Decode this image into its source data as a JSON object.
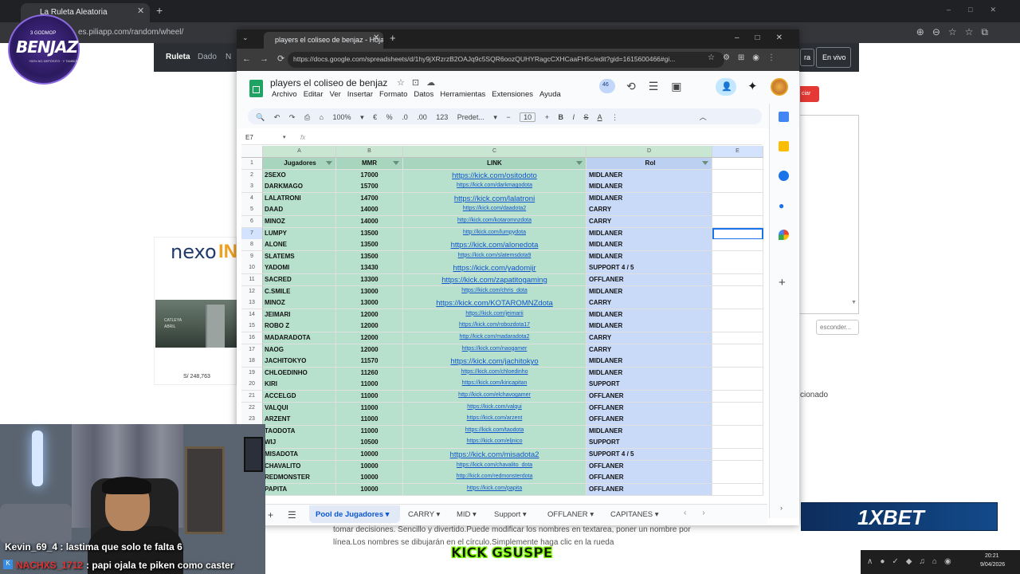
{
  "bg_browser": {
    "tab_title": "La Ruleta Aleatoria",
    "url": "es.piliapp.com/random/wheel/",
    "nav": {
      "roulette": "Ruleta",
      "dado": "Dado",
      "n": "N"
    },
    "nav_btn1": "ra",
    "nav_btn2": "En vivo",
    "red_btn": "ciar",
    "esconder": "esconder...",
    "cionado": "cionado",
    "paragraph": "tomar decisiones. Sencillo y divertido.Puede modificar los nombres en textarea, poner un nombre por línea.Los nombres se dibujarán en el círculo.Simplemente haga clic en la rueda"
  },
  "ad": {
    "logo_a": "nexo",
    "logo_b": "IN",
    "line1": "CATLEYA",
    "line2": "ABRIL",
    "price": "S/ 248,763"
  },
  "stream": {
    "logo_top": "3 GODMOP",
    "logo_name": "BENJAZ",
    "logo_sub": "+50% NO DEPÓSITO · Y TAMBOR",
    "kick": "KICK GSUSPE",
    "sponsor": "1XBET",
    "time": "20:21",
    "date": "9/04/2026"
  },
  "chat": [
    {
      "user": "Kevin_69_4",
      "msg": "lastima que solo te falta 6"
    },
    {
      "user": "NACHXS_1712",
      "msg": ": papi ojala te piken como caster"
    }
  ],
  "sheets": {
    "window_tab": "players el coliseo de benjaz - Hoja",
    "url": "https://docs.google.com/spreadsheets/d/1hy9jXRzrzB2OAJq9c5SQR6oozQUHYRagcCXHCaaFH5c/edit?gid=1615600466#gi...",
    "title": "players el coliseo de benjaz",
    "menu": [
      "Archivo",
      "Editar",
      "Ver",
      "Insertar",
      "Formato",
      "Datos",
      "Herramientas",
      "Extensiones",
      "Ayuda"
    ],
    "toolbar": {
      "zoom": "100%",
      "currency": "€",
      "percent": "%",
      "dec_minus": ".0",
      "dec_plus": ".00",
      "fmt_123": "123",
      "font": "Predet...",
      "font_size": "10",
      "bold": "B",
      "italic": "I",
      "strike": "S",
      "color": "A"
    },
    "badge": "46",
    "namebox": "E7",
    "col_letters": [
      "A",
      "B",
      "C",
      "D",
      "E"
    ],
    "headers": [
      "Jugadores",
      "MMR",
      "LINK",
      "Rol"
    ],
    "rows": [
      [
        "2SEXO",
        "17000",
        "https://kick.com/ositodoto",
        "MIDLANER"
      ],
      [
        "DARKMAGO",
        "15700",
        "https://kick.com/darkmagodota",
        "MIDLANER"
      ],
      [
        "LALATRONI",
        "14700",
        "https://kick.com/lalatroni",
        "MIDLANER"
      ],
      [
        "DAAD",
        "14000",
        "https://kick.com/daadota2",
        "CARRY"
      ],
      [
        "MINOZ",
        "14000",
        "http://kick.com/kotaromnzdota",
        "CARRY"
      ],
      [
        "LUMPY",
        "13500",
        "http://kick.com/lumpydota",
        "MIDLANER"
      ],
      [
        "ALONE",
        "13500",
        "https://kick.com/alonedota",
        "MIDLANER"
      ],
      [
        "SLATEMS",
        "13500",
        "https://kick.com/slatemsdota9",
        "MIDLANER"
      ],
      [
        "YADOMI",
        "13430",
        "https://kick.com/yadomijr",
        "SUPPORT 4 / 5"
      ],
      [
        "SACRED",
        "13300",
        "https://kick.com/zapatitogaming",
        "OFFLANER"
      ],
      [
        "C.SMILE",
        "13000",
        "https://kick.com/chris_dota",
        "MIDLANER"
      ],
      [
        "MINOZ",
        "13000",
        "https://kick.com/KOTAROMNZdota",
        "CARRY"
      ],
      [
        "JEIMARI",
        "12000",
        "https://kick.com/jeimarii",
        "MIDLANER"
      ],
      [
        "ROBO Z",
        "12000",
        "https://kick.com/robozdota17",
        "MIDLANER"
      ],
      [
        "MADARADOTA",
        "12000",
        "http://kick.com/madaradota2",
        "CARRY"
      ],
      [
        "NAOG",
        "12000",
        "https://kick.com/naogamer",
        "CARRY"
      ],
      [
        "JACHITOKYO",
        "11570",
        "https://kick.com/jachitokyo",
        "MIDLANER"
      ],
      [
        "CHLOEDINHO",
        "11260",
        "https://kick.com/chloedinho",
        "MIDLANER"
      ],
      [
        "KIRI",
        "11000",
        "https://kick.com/kiricapitan",
        "SUPPORT"
      ],
      [
        "ACCELGD",
        "11000",
        "http://kick.com/elchavogamer",
        "OFFLANER"
      ],
      [
        "VALQUI",
        "11000",
        "https://kick.com/valqui",
        "OFFLANER"
      ],
      [
        "ARZENT",
        "11000",
        "https://kick.com/arzent",
        "OFFLANER"
      ],
      [
        "TAODOTA",
        "11000",
        "https://kick.com/taodota",
        "MIDLANER"
      ],
      [
        "WIJ",
        "10500",
        "https://kick.com/eljnico",
        "SUPPORT"
      ],
      [
        "MISADOTA",
        "10000",
        "https://kick.com/misadota2",
        "SUPPORT 4 / 5"
      ],
      [
        "CHAVALITO",
        "10000",
        "https://kick.com/chavalito_dota",
        "OFFLANER"
      ],
      [
        "REDMONSTER",
        "10000",
        "http://kick.com/redmonsterdota",
        "OFFLANER"
      ],
      [
        "PAPITA",
        "10000",
        "https://kick.com/papita",
        "OFFLANER"
      ]
    ],
    "sheet_tabs": [
      "Pool de Jugadores",
      "CARRY",
      "MID",
      "Support",
      "OFFLANER",
      "CAPITANES"
    ]
  },
  "colors": {
    "green_cells": "#b7e1cd",
    "blue_cells": "#c9daf8",
    "link": "#1155cc",
    "kick_green": "#7CFC00"
  }
}
